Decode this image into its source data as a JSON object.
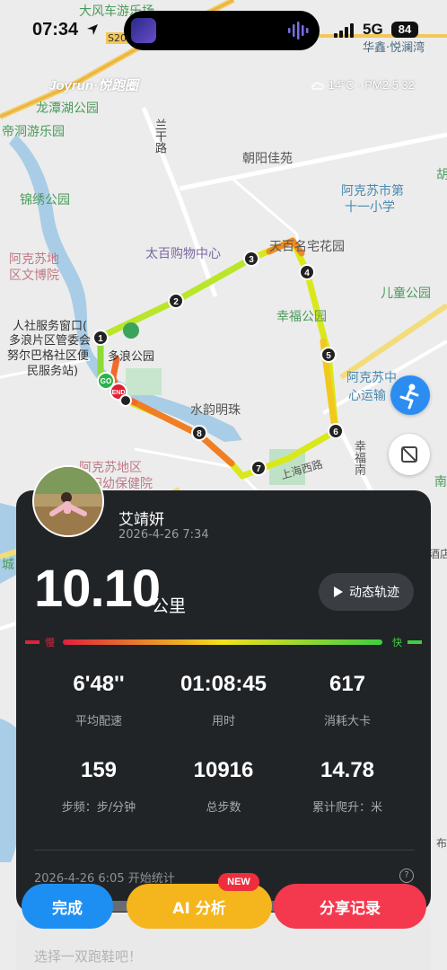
{
  "status_bar": {
    "time": "07:34",
    "network": "5G",
    "battery": "84"
  },
  "map": {
    "brand": "Joyrun·悦跑圈",
    "weather": "14°C · PM2.5 32",
    "labels": [
      {
        "key": "l1",
        "text": "大风车游乐场"
      },
      {
        "key": "l2",
        "text": "S20"
      },
      {
        "key": "l3",
        "text": "华鑫·悦澜湾"
      },
      {
        "key": "l4",
        "text": "龙潭湖公园"
      },
      {
        "key": "l5",
        "text": "帝洞游乐园"
      },
      {
        "key": "l6",
        "text": "兰干路"
      },
      {
        "key": "l7",
        "text": "朝阳佳苑"
      },
      {
        "key": "l8",
        "text": "胡"
      },
      {
        "key": "l9",
        "text": "锦绣公园"
      },
      {
        "key": "l10",
        "text": "阿克苏市第"
      },
      {
        "key": "l11",
        "text": "十一小学"
      },
      {
        "key": "l12",
        "text": "阿克苏地"
      },
      {
        "key": "l13",
        "text": "区文博院"
      },
      {
        "key": "l14",
        "text": "太百购物中心"
      },
      {
        "key": "l15",
        "text": "天百名宅花园"
      },
      {
        "key": "l16",
        "text": "儿童公园"
      },
      {
        "key": "l17",
        "text": "人社服务窗口("
      },
      {
        "key": "l18",
        "text": "多浪片区管委会"
      },
      {
        "key": "l19",
        "text": "努尔巴格社区便"
      },
      {
        "key": "l20",
        "text": "民服务站)"
      },
      {
        "key": "l21",
        "text": "多浪公园"
      },
      {
        "key": "l22",
        "text": "幸福公园"
      },
      {
        "key": "l23",
        "text": "阿克苏中"
      },
      {
        "key": "l24",
        "text": "心运输"
      },
      {
        "key": "l25",
        "text": "水韵明珠"
      },
      {
        "key": "l26",
        "text": "阿克苏地区"
      },
      {
        "key": "l27",
        "text": "妇幼保健院"
      },
      {
        "key": "l28",
        "text": "上海西路"
      },
      {
        "key": "l29",
        "text": "幸福南"
      },
      {
        "key": "l30",
        "text": "南"
      },
      {
        "key": "l31",
        "text": "城"
      },
      {
        "key": "l32",
        "text": "酒店"
      },
      {
        "key": "l33",
        "text": "布"
      }
    ],
    "start_marker": "GO",
    "end_marker": "END",
    "km_markers": [
      "1",
      "2",
      "3",
      "4",
      "5",
      "6",
      "7",
      "8"
    ]
  },
  "run": {
    "user_name": "艾靖妍",
    "datetime": "2026-4-26 7:34",
    "distance": "10.10",
    "distance_unit": "公里",
    "replay_label": "动态轨迹",
    "pace_slow_label": "慢",
    "pace_fast_label": "快",
    "stats": [
      {
        "value": "6'48''",
        "label": "平均配速"
      },
      {
        "value": "01:08:45",
        "label": "用时"
      },
      {
        "value": "617",
        "label": "消耗大卡"
      },
      {
        "value": "159",
        "label": "步频：步/分钟"
      },
      {
        "value": "10916",
        "label": "总步数"
      },
      {
        "value": "14.78",
        "label": "累计爬升：米"
      }
    ],
    "start_note": "2026-4-26 6:05 开始统计"
  },
  "actions": {
    "done": "完成",
    "ai": "AI 分析",
    "ai_badge": "NEW",
    "share": "分享记录"
  },
  "shoe_prompt": "选择一双跑鞋吧！",
  "colors": {
    "done": "#1e8ff2",
    "ai": "#f5b51c",
    "share": "#f4384e",
    "card": "#212427"
  }
}
